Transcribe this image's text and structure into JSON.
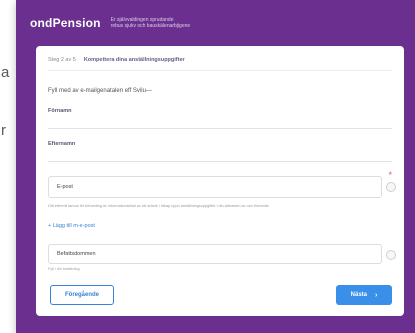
{
  "edge": {
    "char_top": "a",
    "char_mid": "r"
  },
  "header": {
    "brand": "ondPension",
    "tagline_line1": "Er självvaldingen sprudande",
    "tagline_line2": "rebus sjukv och bauskälenarbjigene"
  },
  "breadcrumb": {
    "step": "Steg 2 av 5",
    "current": "Kompettera dina anställningsuppgifter"
  },
  "form": {
    "heading": "Fyll med av e-mailgenatalen eff Svilu—",
    "first_name_label": "Förnamn",
    "last_name_label": "Efternamn",
    "required_mark": "*",
    "email_value": "E-post",
    "email_hint": "Ditt eftermil tamus för behanting av informationsblad av ett arbete i tdkap uppn anställningsuppgifter i diu-alteanten av och förmedla",
    "add_link": "+ Lägg till m-e-post",
    "role_value": "Befattsdommen",
    "role_hint": "Fyll i din befattning"
  },
  "buttons": {
    "back_label": "Föregående",
    "next_label": "Nästa",
    "next_chevron": "›"
  },
  "colors": {
    "frame": "#6a2f8f",
    "accent": "#3a82d6",
    "required": "#e0556b"
  }
}
